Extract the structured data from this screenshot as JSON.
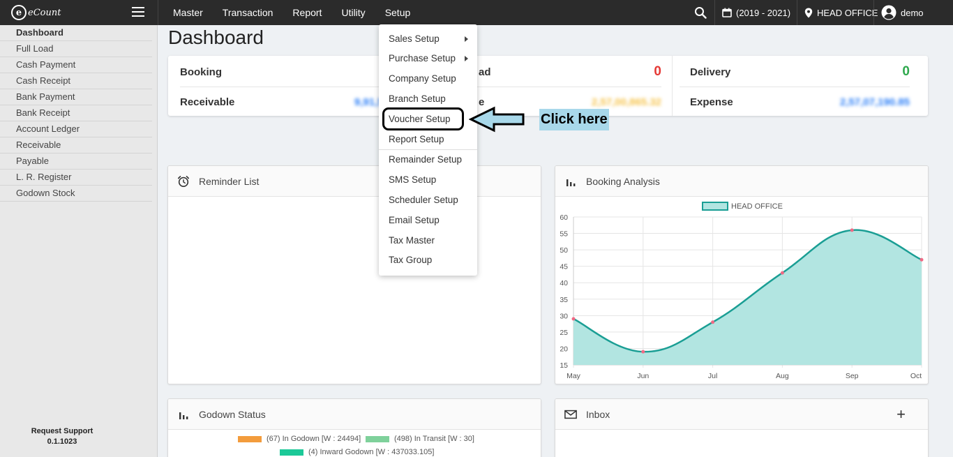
{
  "app": {
    "logo_letter": "e",
    "logo_text": "eCount"
  },
  "nav": [
    {
      "label": "Master"
    },
    {
      "label": "Transaction"
    },
    {
      "label": "Report"
    },
    {
      "label": "Utility"
    },
    {
      "label": "Setup"
    }
  ],
  "topbar": {
    "year": "(2019 - 2021)",
    "branch": "HEAD OFFICE",
    "user": "demo"
  },
  "sidebar": {
    "items": [
      {
        "label": "Dashboard"
      },
      {
        "label": "Full Load"
      },
      {
        "label": "Cash Payment"
      },
      {
        "label": "Cash Receipt"
      },
      {
        "label": "Bank Payment"
      },
      {
        "label": "Bank Receipt"
      },
      {
        "label": "Account Ledger"
      },
      {
        "label": "Receivable"
      },
      {
        "label": "Payable"
      },
      {
        "label": "L. R. Register"
      },
      {
        "label": "Godown Stock"
      }
    ],
    "support_label": "Request Support",
    "version": "0.1.1023"
  },
  "page": {
    "title": "Dashboard"
  },
  "stats": {
    "booking_label": "Booking",
    "receivable_label": "Receivable",
    "receivable_value": "9,91,56,54,997",
    "load_label": "ad",
    "load_value": "0",
    "payable_label": "e",
    "payable_value": "2,57,00,865.32",
    "delivery_label": "Delivery",
    "delivery_value": "0",
    "expense_label": "Expense",
    "expense_value": "2,57,07,190.85"
  },
  "panels": {
    "reminder_title": "Reminder List",
    "booking_title": "Booking Analysis",
    "godown_title": "Godown Status",
    "inbox_title": "Inbox",
    "inbox_add": "+"
  },
  "godown_legend": [
    {
      "label": "(67) In Godown [W : 24494]",
      "color": "#f39c3c"
    },
    {
      "label": "(498) In Transit [W : 30]",
      "color": "#7fd19b"
    },
    {
      "label": "(4) Inward Godown [W : 437033.105]",
      "color": "#1cc998"
    }
  ],
  "setup_menu": [
    {
      "label": "Sales Setup",
      "submenu": true
    },
    {
      "label": "Purchase Setup",
      "submenu": true
    },
    {
      "label": "Company Setup",
      "submenu": false
    },
    {
      "label": "Branch Setup",
      "submenu": false
    },
    {
      "label": "Voucher Setup",
      "submenu": false
    },
    {
      "label": "Report Setup",
      "submenu": false
    },
    {
      "label": "Remainder Setup",
      "submenu": false
    },
    {
      "label": "SMS Setup",
      "submenu": false
    },
    {
      "label": "Scheduler Setup",
      "submenu": false
    },
    {
      "label": "Email Setup",
      "submenu": false
    },
    {
      "label": "Tax Master",
      "submenu": false
    },
    {
      "label": "Tax Group",
      "submenu": false
    }
  ],
  "annotation": {
    "label": "Click here"
  },
  "chart_data": {
    "type": "area",
    "categories": [
      "May",
      "Jun",
      "Jul",
      "Aug",
      "Sep",
      "Oct"
    ],
    "series": [
      {
        "name": "HEAD OFFICE",
        "values": [
          29,
          19,
          28,
          43,
          56,
          47
        ]
      }
    ],
    "yticks": [
      60,
      55,
      50,
      45,
      40,
      35,
      30,
      25,
      20,
      15
    ],
    "ylim": [
      15,
      60
    ],
    "grid": true,
    "legend": "top-center",
    "colors": {
      "line": "#1a9e94",
      "fill": "#b2e5e1",
      "point": "#f06a85"
    }
  }
}
